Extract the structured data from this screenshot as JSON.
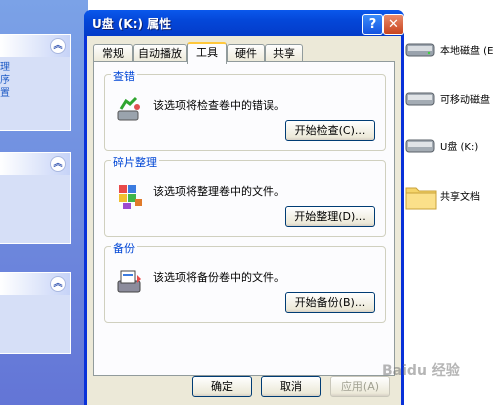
{
  "explorer": {
    "left_panels": [
      {
        "links": [
          "理",
          "序",
          "置"
        ]
      },
      {
        "links": []
      },
      {
        "links": []
      }
    ],
    "drives": [
      {
        "label": "本地磁盘 (E",
        "icon": "hard-disk-icon"
      },
      {
        "label": "可移动磁盘",
        "icon": "removable-disk-icon"
      },
      {
        "label": "U盘 (K:)",
        "icon": "usb-drive-icon"
      },
      {
        "label": "共享文档",
        "icon": "folder-icon"
      }
    ]
  },
  "dialog": {
    "title": "U盘 (K:) 属性",
    "tabs": [
      "常规",
      "自动播放",
      "工具",
      "硬件",
      "共享"
    ],
    "active_tab": "工具",
    "groups": [
      {
        "title": "查错",
        "desc": "该选项将检查卷中的错误。",
        "button": "开始检查(C)...",
        "icon": "check-disk-icon"
      },
      {
        "title": "碎片整理",
        "desc": "该选项将整理卷中的文件。",
        "button": "开始整理(D)...",
        "icon": "defrag-icon"
      },
      {
        "title": "备份",
        "desc": "该选项将备份卷中的文件。",
        "button": "开始备份(B)...",
        "icon": "backup-icon"
      }
    ],
    "footer": {
      "ok": "确定",
      "cancel": "取消",
      "apply": "应用(A)"
    }
  },
  "watermark": "Baidu 经验"
}
